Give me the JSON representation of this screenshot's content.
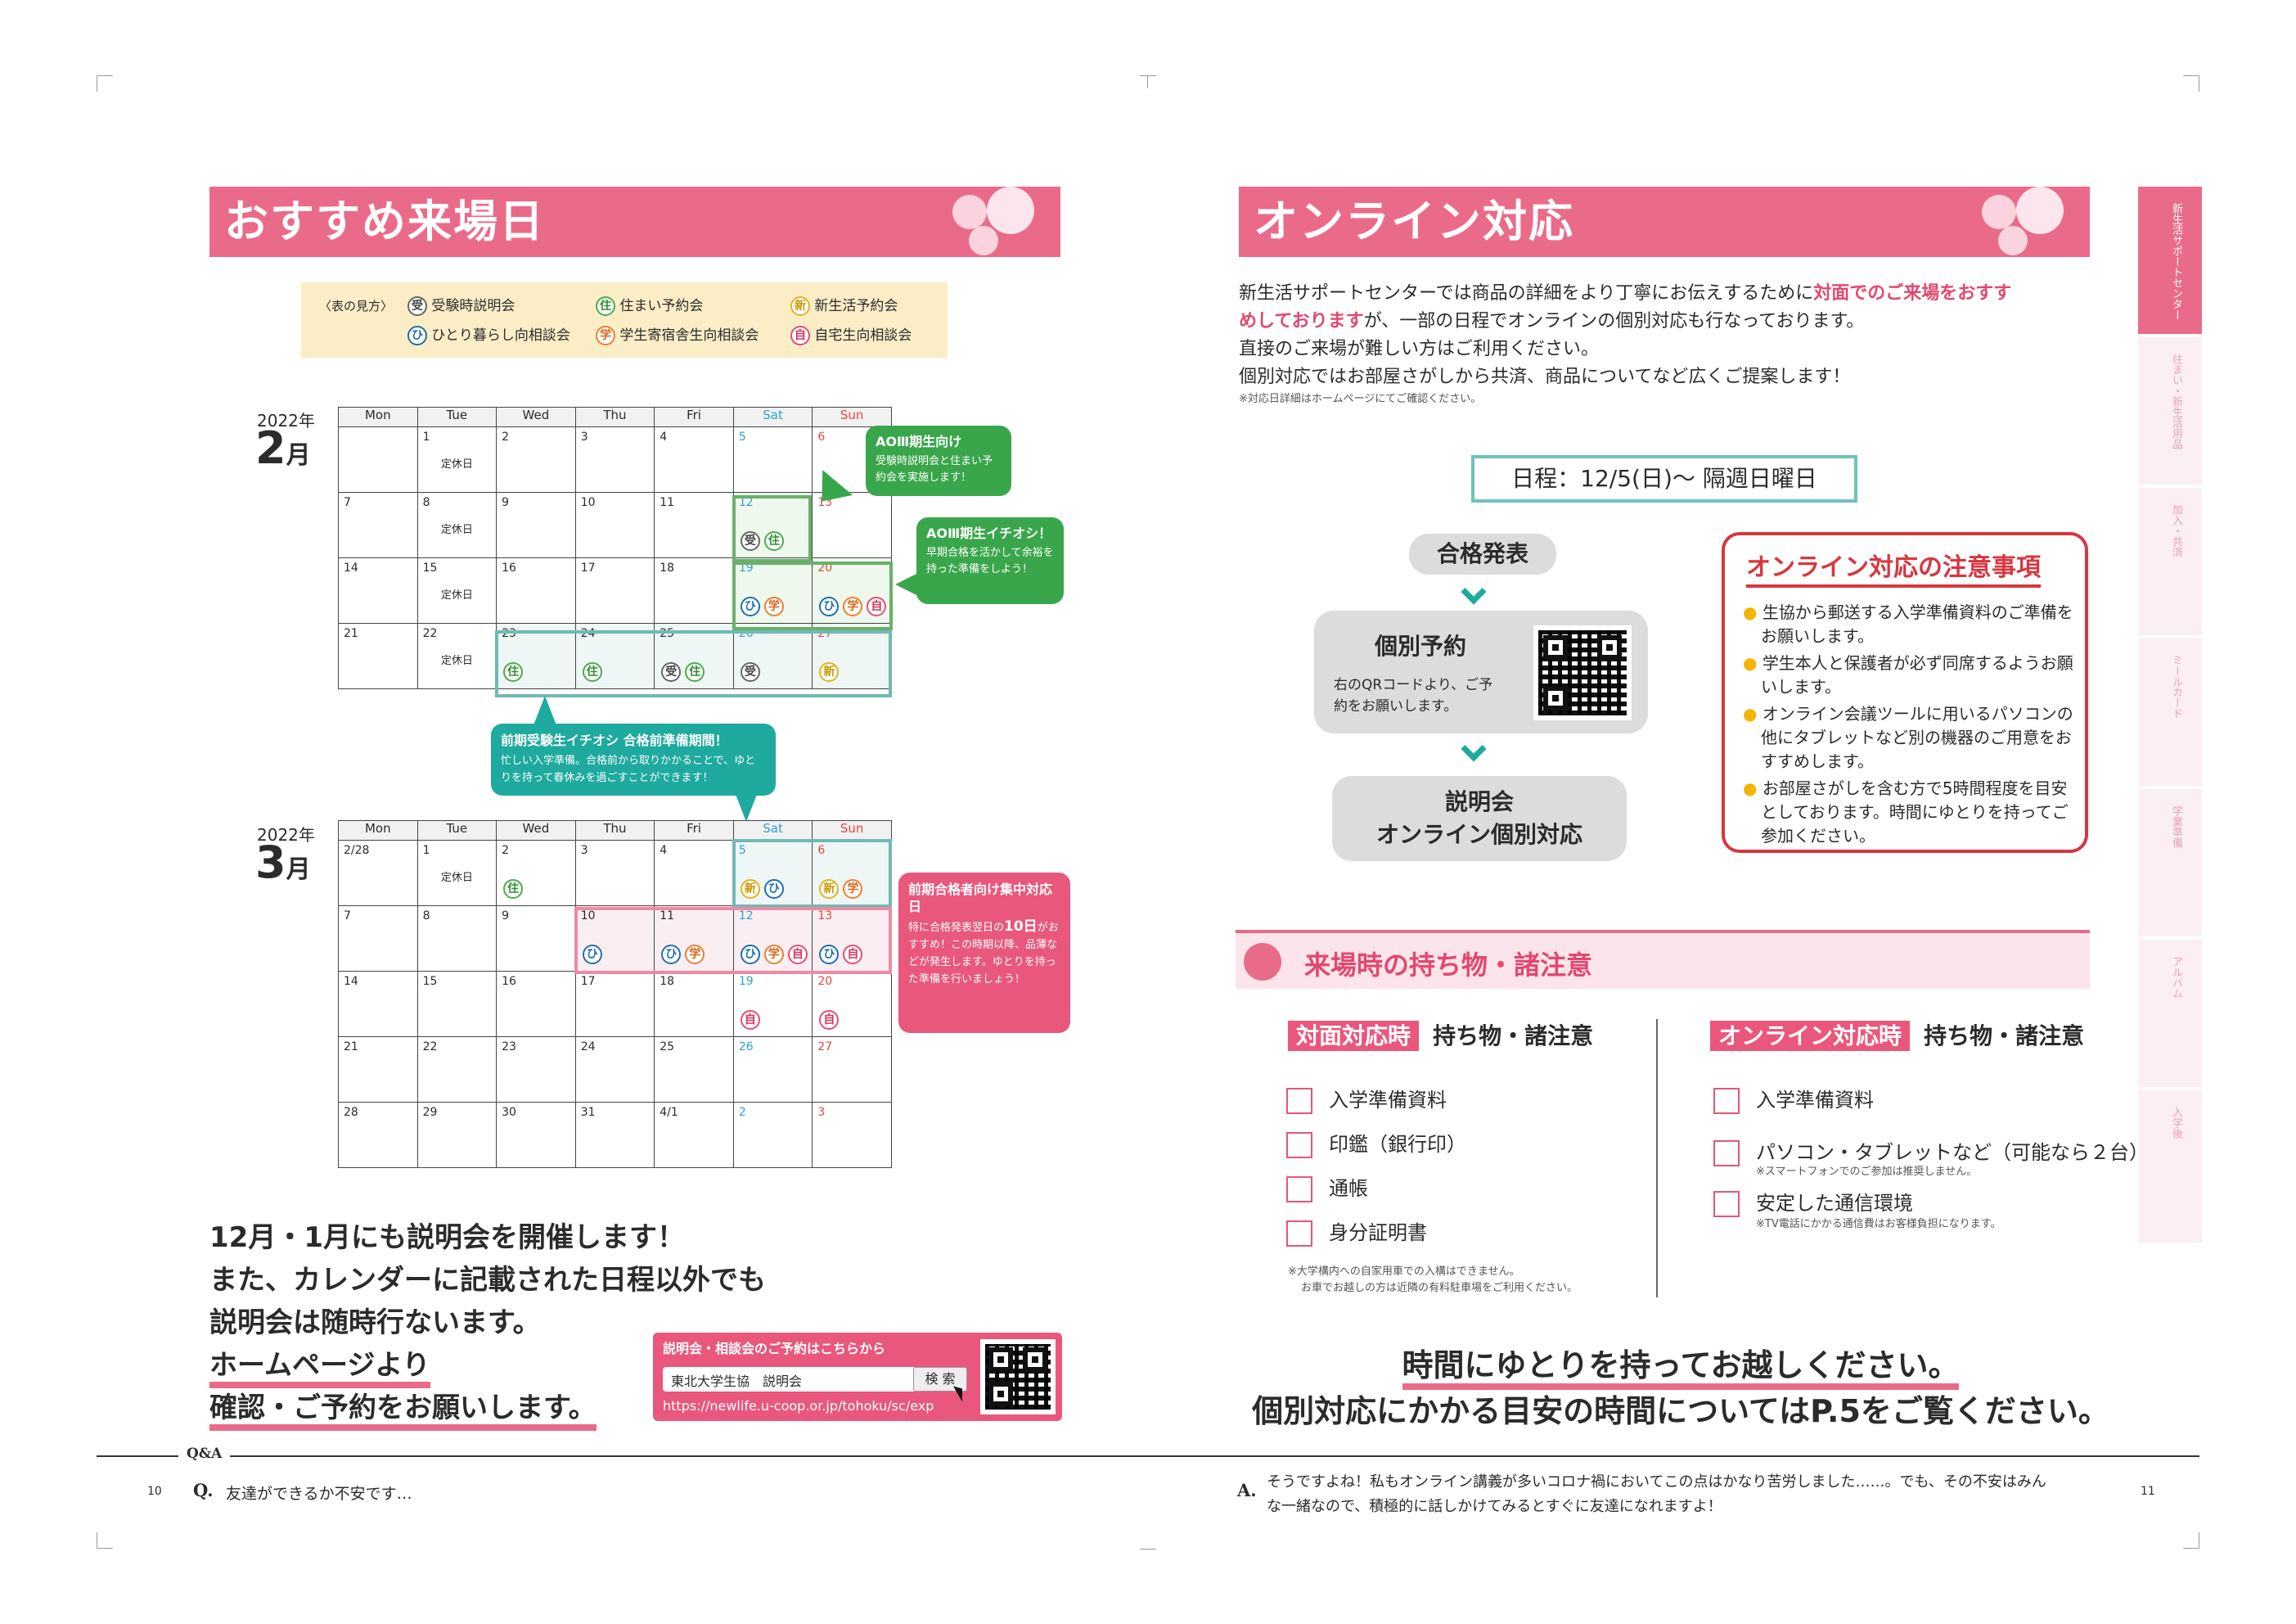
{
  "left": {
    "banner_title": "おすすめ来場日",
    "legend": {
      "label": "〈表の見方〉",
      "items": [
        {
          "icon": "受",
          "text": "受験時説明会"
        },
        {
          "icon": "住",
          "text": "住まい予約会"
        },
        {
          "icon": "新",
          "text": "新生活予約会"
        },
        {
          "icon": "ひ",
          "text": "ひとり暮らし向相談会"
        },
        {
          "icon": "学",
          "text": "学生寄宿舎生向相談会"
        },
        {
          "icon": "自",
          "text": "自宅生向相談会"
        }
      ]
    },
    "weekdays": [
      "Mon",
      "Tue",
      "Wed",
      "Thu",
      "Fri",
      "Sat",
      "Sun"
    ],
    "closed_label": "定休日",
    "feb": {
      "year": "2022年",
      "month": "2",
      "month_suffix": "月",
      "rows": [
        [
          {
            "d": ""
          },
          {
            "d": "1",
            "closed": true
          },
          {
            "d": "2"
          },
          {
            "d": "3"
          },
          {
            "d": "4"
          },
          {
            "d": "5"
          },
          {
            "d": "6"
          }
        ],
        [
          {
            "d": "7"
          },
          {
            "d": "8",
            "closed": true
          },
          {
            "d": "9"
          },
          {
            "d": "10"
          },
          {
            "d": "11"
          },
          {
            "d": "12",
            "ic": [
              "受",
              "住"
            ]
          },
          {
            "d": "13"
          }
        ],
        [
          {
            "d": "14"
          },
          {
            "d": "15",
            "closed": true
          },
          {
            "d": "16"
          },
          {
            "d": "17"
          },
          {
            "d": "18"
          },
          {
            "d": "19",
            "ic": [
              "ひ",
              "学"
            ]
          },
          {
            "d": "20",
            "ic": [
              "ひ",
              "学",
              "自"
            ]
          }
        ],
        [
          {
            "d": "21"
          },
          {
            "d": "22",
            "closed": true
          },
          {
            "d": "23",
            "ic": [
              "住"
            ]
          },
          {
            "d": "24",
            "ic": [
              "住"
            ]
          },
          {
            "d": "25",
            "ic": [
              "受",
              "住"
            ]
          },
          {
            "d": "26",
            "ic": [
              "受"
            ]
          },
          {
            "d": "27",
            "ic": [
              "新"
            ]
          }
        ]
      ]
    },
    "mar": {
      "year": "2022年",
      "month": "3",
      "month_suffix": "月",
      "rows": [
        [
          {
            "d": "2/28"
          },
          {
            "d": "1",
            "closed": true
          },
          {
            "d": "2",
            "ic": [
              "住"
            ]
          },
          {
            "d": "3"
          },
          {
            "d": "4"
          },
          {
            "d": "5",
            "ic": [
              "新",
              "ひ"
            ]
          },
          {
            "d": "6",
            "ic": [
              "新",
              "学"
            ]
          }
        ],
        [
          {
            "d": "7"
          },
          {
            "d": "8"
          },
          {
            "d": "9"
          },
          {
            "d": "10",
            "ic": [
              "ひ"
            ]
          },
          {
            "d": "11",
            "ic": [
              "ひ",
              "学"
            ]
          },
          {
            "d": "12",
            "ic": [
              "ひ",
              "学",
              "自"
            ]
          },
          {
            "d": "13",
            "ic": [
              "ひ",
              "自"
            ]
          }
        ],
        [
          {
            "d": "14"
          },
          {
            "d": "15"
          },
          {
            "d": "16"
          },
          {
            "d": "17"
          },
          {
            "d": "18"
          },
          {
            "d": "19",
            "ic": [
              "自"
            ]
          },
          {
            "d": "20",
            "ic": [
              "自"
            ]
          }
        ],
        [
          {
            "d": "21"
          },
          {
            "d": "22"
          },
          {
            "d": "23"
          },
          {
            "d": "24"
          },
          {
            "d": "25"
          },
          {
            "d": "26"
          },
          {
            "d": "27"
          }
        ],
        [
          {
            "d": "28"
          },
          {
            "d": "29"
          },
          {
            "d": "30"
          },
          {
            "d": "31"
          },
          {
            "d": "4/1"
          },
          {
            "d": "2"
          },
          {
            "d": "3"
          }
        ]
      ]
    },
    "callouts": {
      "ao3_title": "AOⅢ期生向け",
      "ao3_text": "受験時説明会と住まい予約会を実施します！",
      "ao3b_title": "AOⅢ期生イチオシ！",
      "ao3b_text": "早期合格を活かして余裕を持った準備をしよう！",
      "zenki_title": "前期受験生イチオシ 合格前準備期間！",
      "zenki_text": "忙しい入学準備。合格前から取りかかることで、ゆとりを持って春休みを過ごすことができます！",
      "goukaku_title": "前期合格者向け集中対応日",
      "goukaku_text1": "特に合格発表翌日の",
      "goukaku_day": "10日",
      "goukaku_text2": "がおすすめ！この時期以降、品薄などが発生します。ゆとりを持った準備を行いましょう！"
    },
    "bottom_lines": [
      "12月・1月にも説明会を開催します！",
      "また、カレンダーに記載された日程以外でも",
      "説明会は随時行ないます。",
      "ホームページより",
      "確認・ご予約をお願いします。"
    ],
    "reserve": {
      "header": "説明会・相談会のご予約はこちらから",
      "search_value": "東北大学生協　説明会",
      "search_button": "検 索",
      "url": "https://newlife.u-coop.or.jp/tohoku/sc/exp"
    }
  },
  "right": {
    "banner_title": "オンライン対応",
    "intro_1a": "新生活サポートセンターでは商品の詳細をより丁寧にお伝えするために",
    "intro_1b": "対面でのご来場をおすす",
    "intro_2a": "めしております",
    "intro_2b": "が、一部の日程でオンラインの個別対応も行なっております。",
    "intro_3": "直接のご来場が難しい方はご利用ください。",
    "intro_4": "個別対応ではお部屋さがしから共済、商品についてなど広くご提案します！",
    "intro_note": "※対応日詳細はホームページにてご確認ください。",
    "schedule": "日程：12/5(日)〜 隔週日曜日",
    "flow": {
      "step1": "合格発表",
      "step2_title": "個別予約",
      "step2_text": "右のQRコードより、ご予約をお願いします。",
      "step3_line1": "説明会",
      "step3_line2": "オンライン個別対応"
    },
    "caution": {
      "title": "オンライン対応の注意事項",
      "items": [
        "生協から郵送する入学準備資料のご準備をお願いします。",
        "学生本人と保護者が必ず同席するようお願いします。",
        "オンライン会議ツールに用いるパソコンの他にタブレットなど別の機器のご用意をおすすめします。",
        "お部屋さがしを含む方で5時間程度を目安としております。時間にゆとりを持ってご参加ください。"
      ]
    },
    "belongings_title": "来場時の持ち物・諸注意",
    "inperson": {
      "tag": "対面対応時",
      "heading": "持ち物・諸注意",
      "items": [
        "入学準備資料",
        "印鑑（銀行印）",
        "通帳",
        "身分証明書"
      ],
      "note1": "※大学構内への自家用車での入構はできません。",
      "note2": "お車でお越しの方は近隣の有料駐車場をご利用ください。"
    },
    "online": {
      "tag": "オンライン対応時",
      "heading": "持ち物・諸注意",
      "items": [
        "入学準備資料",
        "パソコン・タブレットなど（可能なら２台）",
        "安定した通信環境"
      ],
      "note_pc": "※スマートフォンでのご参加は推奨しません。",
      "note_net": "※TV電話にかかる通信費はお客様負担になります。"
    },
    "closing_1": "時間にゆとりを持ってお越しください。",
    "closing_2": "個別対応にかかる目安の時間についてはP.5をご覧ください。",
    "side_tabs": [
      "新生活サポートセンター",
      "住まい・新生活用品",
      "加入・共済",
      "ミールカード",
      "学業準備",
      "アルバム",
      "入学後"
    ]
  },
  "footer": {
    "qa_label": "Q&A",
    "page_left": "10",
    "q_mark": "Q.",
    "question": "友達ができるか不安です…",
    "a_mark": "A.",
    "answer_1": "そうですよね！私もオンライン講義が多いコロナ禍においてこの点はかなり苦労しました……。でも、その不安はみん",
    "answer_2": "な一緒なので、積極的に話しかけてみるとすぐに友達になれますよ！",
    "page_right": "11"
  }
}
